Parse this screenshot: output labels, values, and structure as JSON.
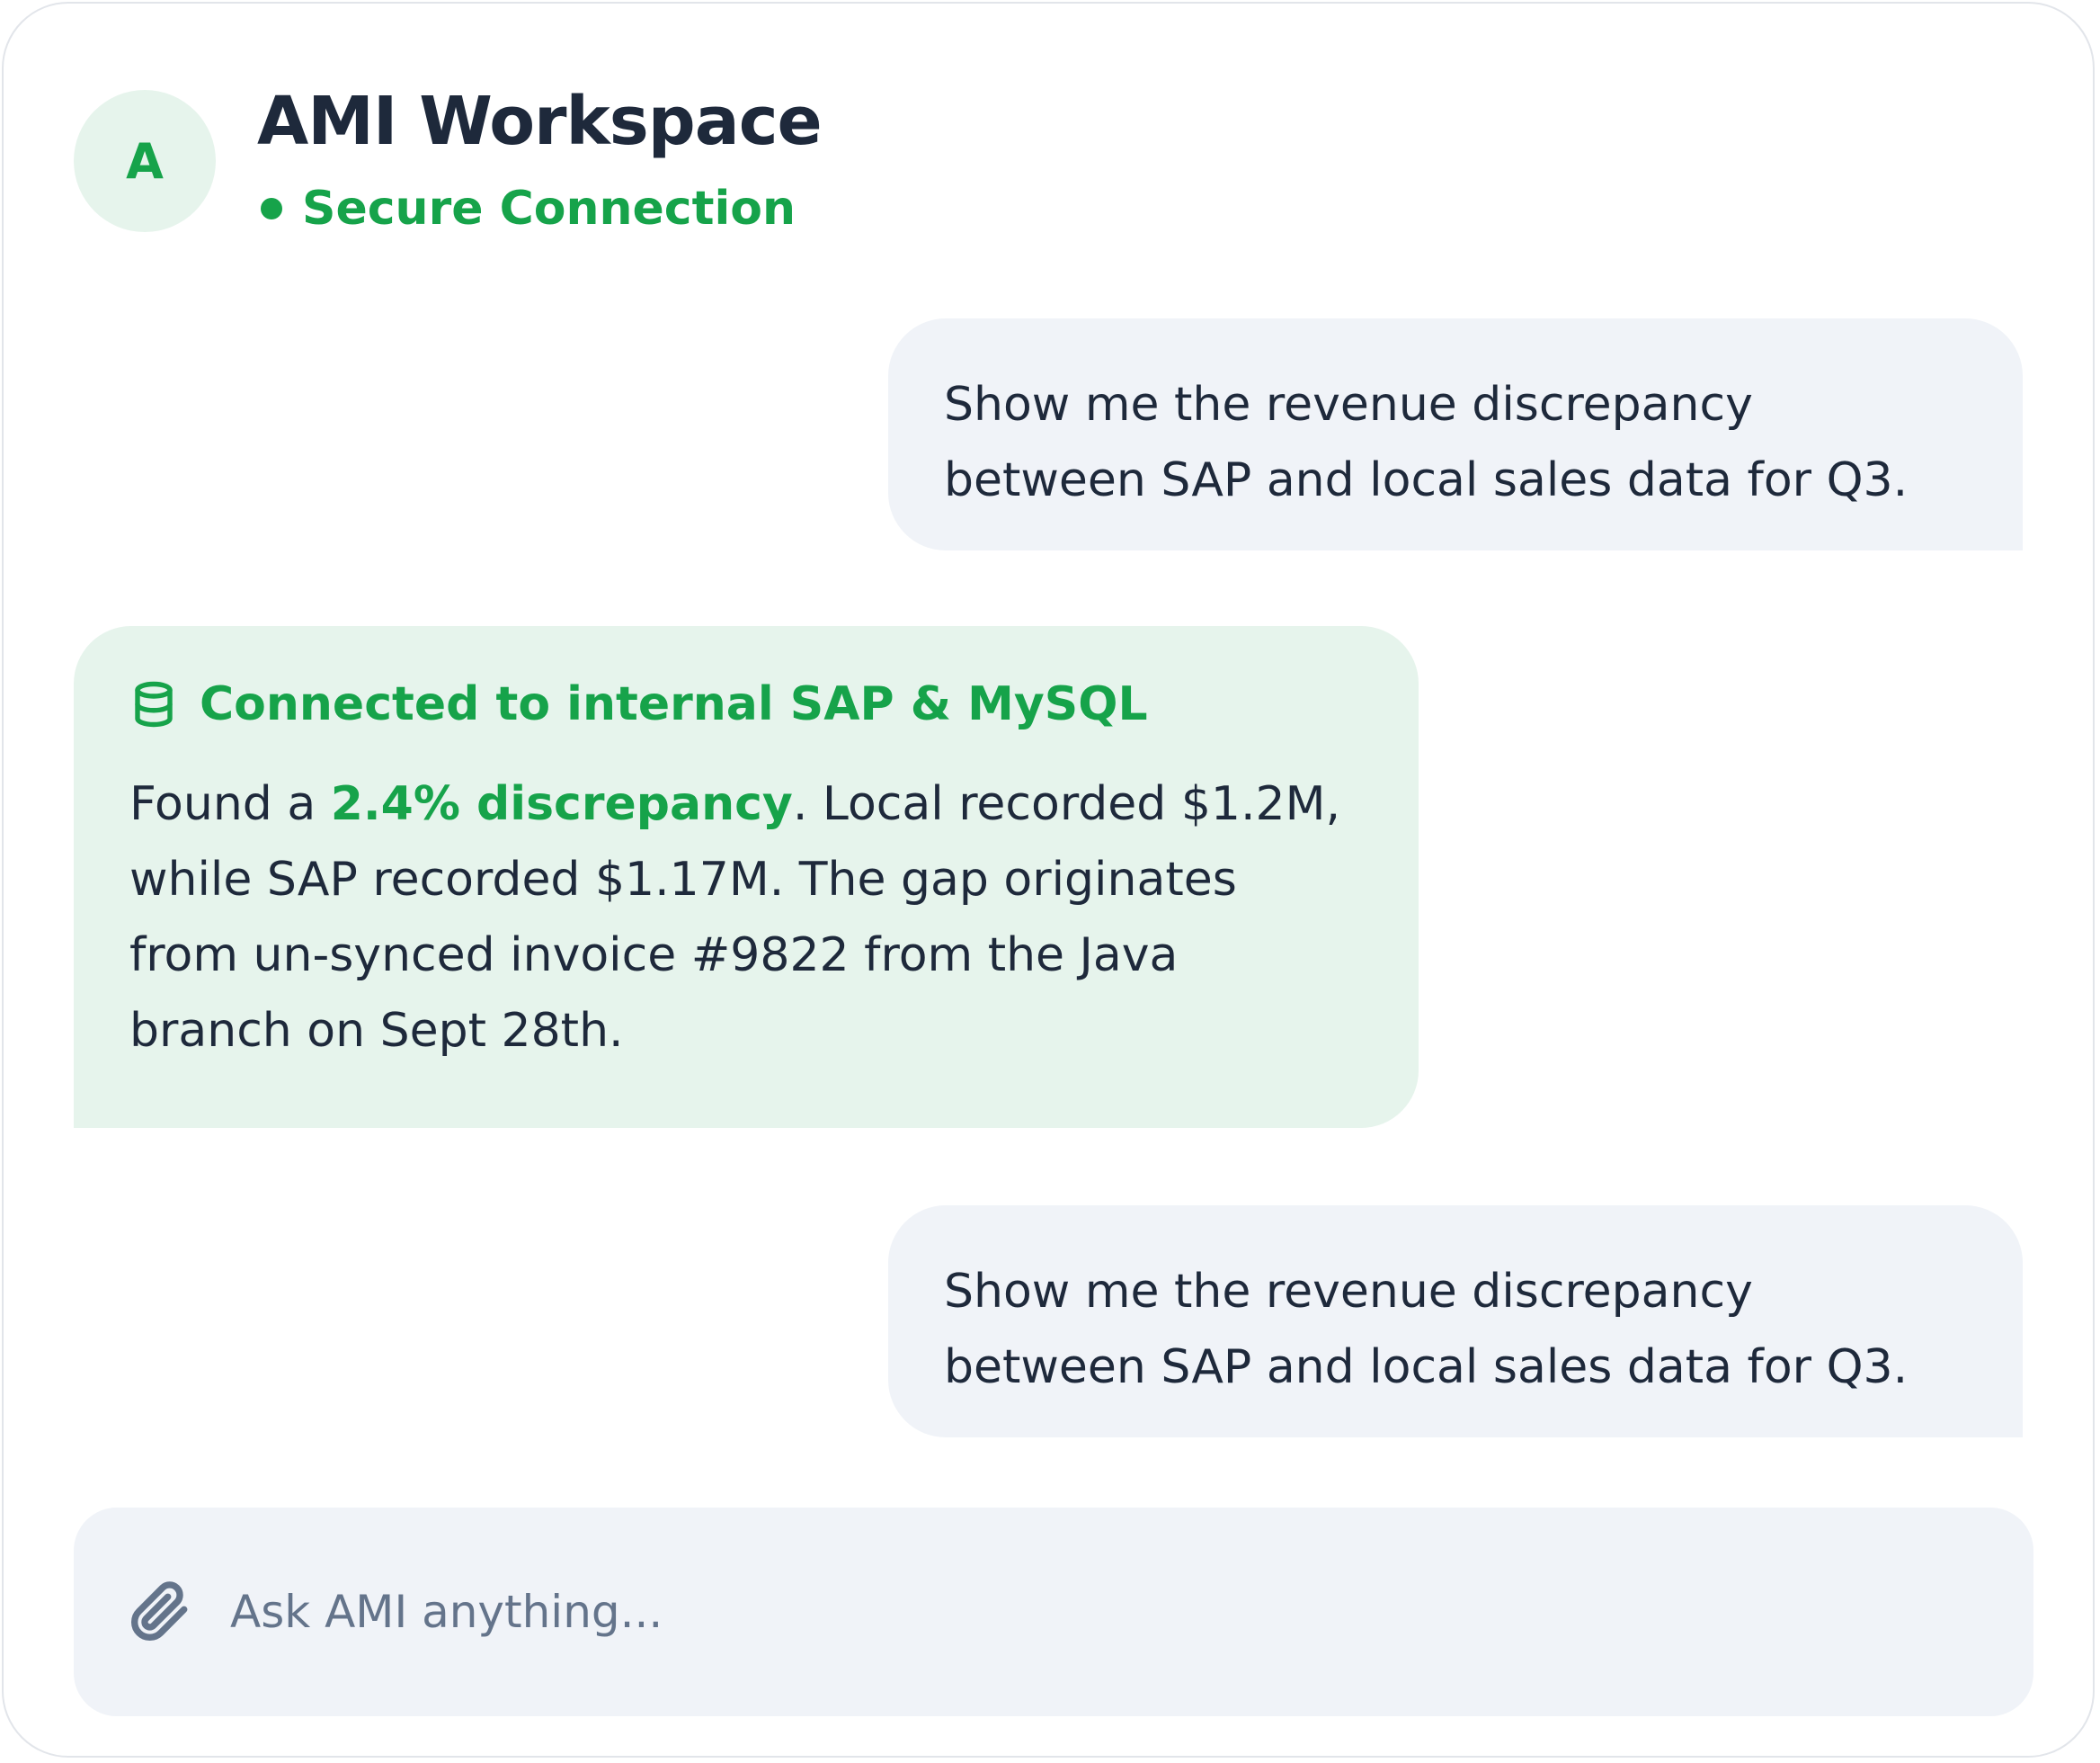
{
  "header": {
    "avatar_letter": "A",
    "title": "AMI Workspace",
    "status": "Secure Connection"
  },
  "messages": [
    {
      "role": "user",
      "lines": [
        "Show me the revenue discrepancy",
        "between SAP and local sales data for Q3."
      ]
    },
    {
      "role": "assistant",
      "source_icon": "database-icon",
      "source_label": "Connected to internal SAP & MySQL",
      "lines": [
        {
          "before": "Found a ",
          "highlight": "2.4% discrepancy",
          "after": ". Local recorded $1.2M,"
        },
        "while SAP recorded $1.17M. The gap originates",
        "from un-synced invoice #9822 from the Java",
        "branch on Sept 28th."
      ]
    },
    {
      "role": "user",
      "lines": [
        "Show me the revenue discrepancy",
        "between SAP and local sales data for Q3."
      ]
    }
  ],
  "composer": {
    "attach_icon": "paperclip-icon",
    "placeholder": "Ask AMI anything...",
    "value": ""
  },
  "colors": {
    "accent": "#16a34a",
    "assistant_bubble": "#e6f4ec",
    "user_bubble": "#f0f3f8",
    "text": "#1e293b",
    "placeholder": "#64748b"
  }
}
